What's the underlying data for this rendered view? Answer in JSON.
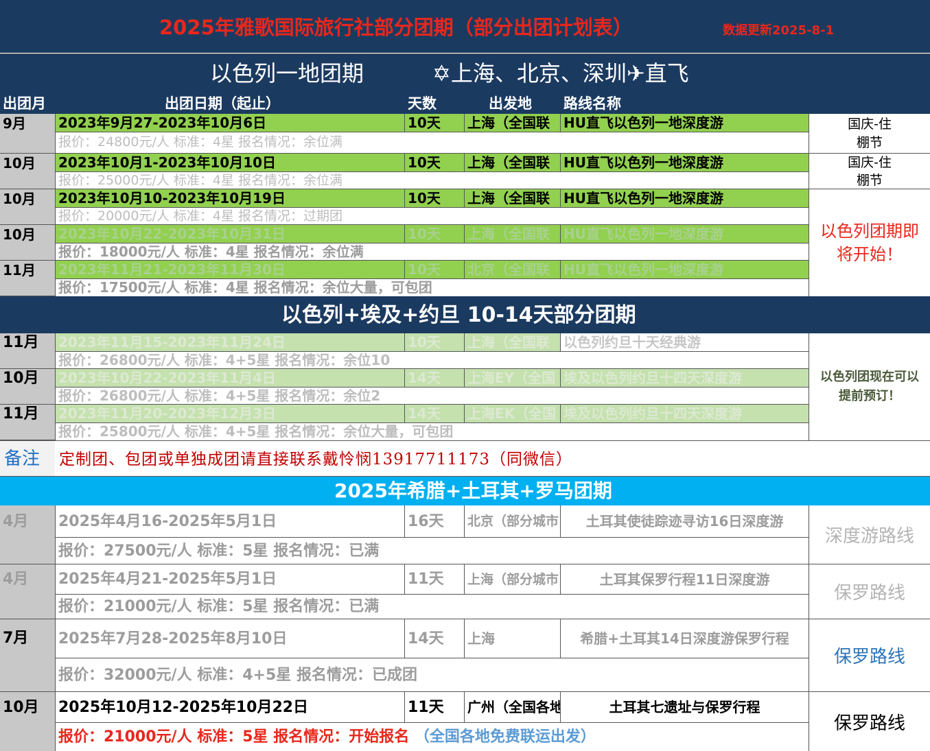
{
  "header": {
    "title": "2025年雅歌国际旅行社部分团期（部分出团计划表）",
    "updated": "数据更新2025-8-1"
  },
  "israel": {
    "title": "以色列一地团期",
    "cities": "✡上海、北京、深圳✈直飞",
    "columns": [
      "出团月",
      "出团日期（起止）",
      "天数",
      "出发地",
      "路线名称"
    ],
    "rows": [
      {
        "month": "9月",
        "dates": "2023年9月27-2023年10月6日",
        "days": "10天",
        "origin": "上海（全国联",
        "route": "HU直飞以色列一地深度游",
        "price": "报价：24800元/人  标准：4星   报名情况：余位满",
        "note": "国庆-住棚节"
      },
      {
        "month": "10月",
        "dates": "2023年10月1-2023年10月10日",
        "days": "10天",
        "origin": "上海（全国联",
        "route": "HU直飞以色列一地深度游",
        "price": "报价：25000元/人  标准：4星   报名情况：余位满",
        "note": "国庆-住棚节"
      },
      {
        "month": "10月",
        "dates": "2023年10月10-2023年10月19日",
        "days": "10天",
        "origin": "上海（全国联",
        "route": "HU直飞以色列一地深度游",
        "price": "报价：20000元/人  标准：4星   报名情况：过期团"
      },
      {
        "month": "10月",
        "dates": "2023年10月22-2023年10月31日",
        "days": "10天",
        "origin": "上海（全国联",
        "route": "HU直飞以色列一地深度游",
        "price": "报价：18000元/人 标准：4星  报名情况：余位满"
      },
      {
        "month": "11月",
        "dates": "2023年11月21-2023年11月30日",
        "days": "10天",
        "origin": "北京（全国联",
        "route": "HU直飞以色列一地深度游",
        "price": "报价：17500元/人 标准：4星  报名情况：余位大量，可包团"
      }
    ],
    "side_note": "以色列团期即将开始！"
  },
  "combo": {
    "title": "以色列+埃及+约旦 10-14天部分团期",
    "rows": [
      {
        "month": "11月",
        "dates": "2023年11月15-2023年11月24日",
        "days": "10天",
        "origin": "上海（全国联",
        "route": "以色列约旦十天经典游",
        "price": "报价：26800元/人  标准：4+5星   报名情况：余位10"
      },
      {
        "month": "10月",
        "dates": "2023年10月22-2023年11月4日",
        "days": "14天",
        "origin": "上海EY（全国",
        "route": "埃及以色列约旦十四天深度游",
        "price": "报价：26800元/人  标准：4+5星   报名情况：余位2"
      },
      {
        "month": "11月",
        "dates": "2023年11月20-2023年12月3日",
        "days": "14天",
        "origin": "上海EK（全国",
        "route": "埃及以色列约旦十四天深度游",
        "price": "报价：25800元/人  标准：4+5星   报名情况：余位大量，可包团"
      }
    ],
    "side_note": "以色列团现在可以提前预订！"
  },
  "remark": {
    "label": "备注",
    "text": "定制团、包团或单独成团请直接联系戴怜悯13917711173（同微信）"
  },
  "greece": {
    "title": "2025年希腊+土耳其+罗马团期",
    "rows": [
      {
        "month": "4月",
        "dates": "2025年4月16-2025年5月1日",
        "days": "16天",
        "origin": "北京（部分城市",
        "route": "土耳其使徒踪迹寻访16日深度游",
        "price": "报价：27500元/人  标准：5星   报名情况：已满",
        "note": "深度游路线"
      },
      {
        "month": "4月",
        "dates": "2025年4月21-2025年5月1日",
        "days": "11天",
        "origin": "上海（部分城市",
        "route": "土耳其保罗行程11日深度游",
        "price": "报价：21000元/人  标准：5星   报名情况：已满",
        "note": "保罗路线"
      },
      {
        "month": "7月",
        "dates": "2025年7月28-2025年8月10日",
        "days": "14天",
        "origin": "上海",
        "route": "希腊+土耳其14日深度游保罗行程",
        "price": "报价：32000元/人  标准：4+5星   报名情况：已成团",
        "note": "保罗路线"
      },
      {
        "month": "10月",
        "dates": "2025年10月12-2025年10月22日",
        "days": "11天",
        "origin": "广州（全国各地",
        "route": "土耳其七遗址与保罗行程",
        "price": "报价：21000元/人  标准：5星   报名情况：开始报名",
        "price_extra": "（全国各地免费联运出发）",
        "note": "保罗路线"
      }
    ]
  },
  "colors": {
    "navy": "#1b3a60",
    "title_red": "#e8271c",
    "cyan": "#00b0f0",
    "green": "#92d050",
    "remark_blue": "#1f6fc5",
    "note_blue": "#2e75b6"
  }
}
